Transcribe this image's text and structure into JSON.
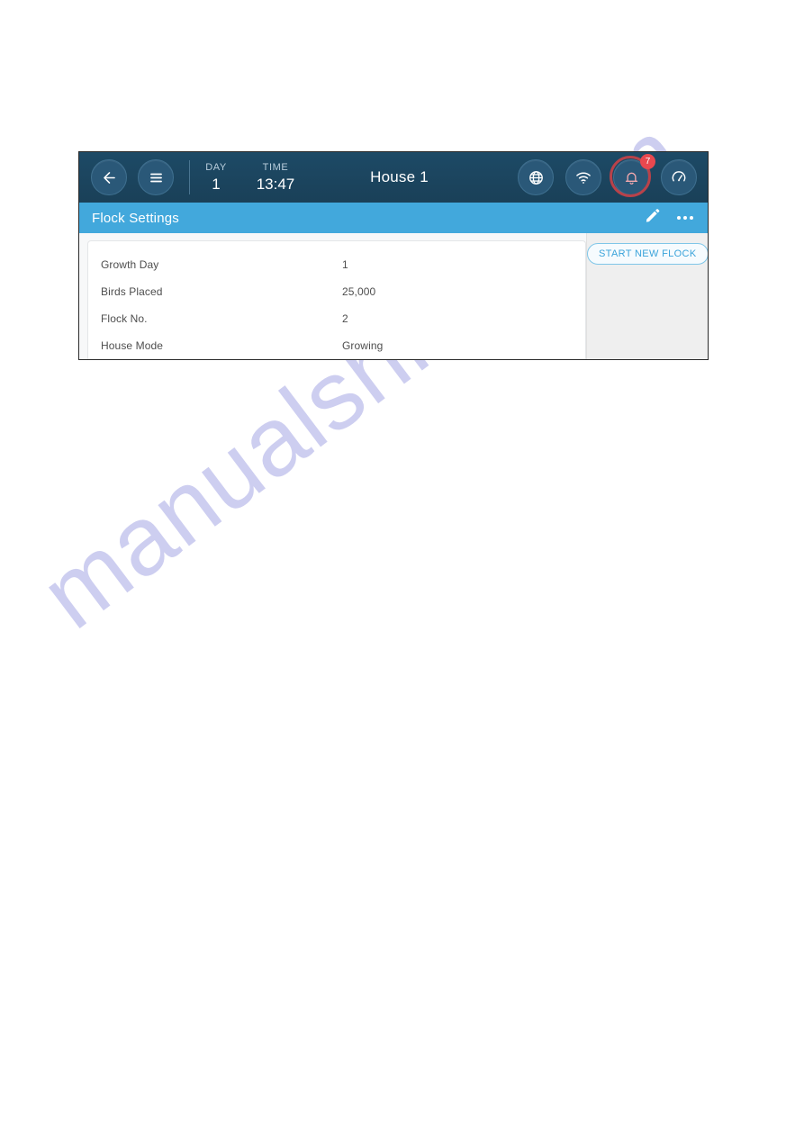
{
  "watermark": {
    "text": "manualshive.com"
  },
  "topbar": {
    "back_icon": "arrow-left-icon",
    "menu_icon": "hamburger-menu-icon",
    "day_label": "DAY",
    "day_value": "1",
    "time_label": "TIME",
    "time_value": "13:47",
    "house_title": "House 1",
    "globe_icon": "globe-icon",
    "wifi_icon": "wifi-icon",
    "alarm_icon": "bell-alarm-icon",
    "alarm_badge": "7",
    "gauge_icon": "gauge-speedometer-icon",
    "colors": {
      "background": "#1b4560",
      "button_fill": "#2a5878",
      "alarm_ring": "#b8424a",
      "badge": "#e8484f"
    }
  },
  "subbar": {
    "title": "Flock Settings",
    "edit_icon": "pencil-edit-icon",
    "more_icon": "more-options-icon",
    "color": "#42a8dc"
  },
  "settings": {
    "rows": [
      {
        "label": "Growth Day",
        "value": "1"
      },
      {
        "label": "Birds Placed",
        "value": "25,000"
      },
      {
        "label": "Flock No.",
        "value": "2"
      },
      {
        "label": "House Mode",
        "value": "Growing"
      }
    ]
  },
  "sidebar": {
    "start_new_flock_label": "START NEW FLOCK",
    "accent": "#3aa3da"
  }
}
